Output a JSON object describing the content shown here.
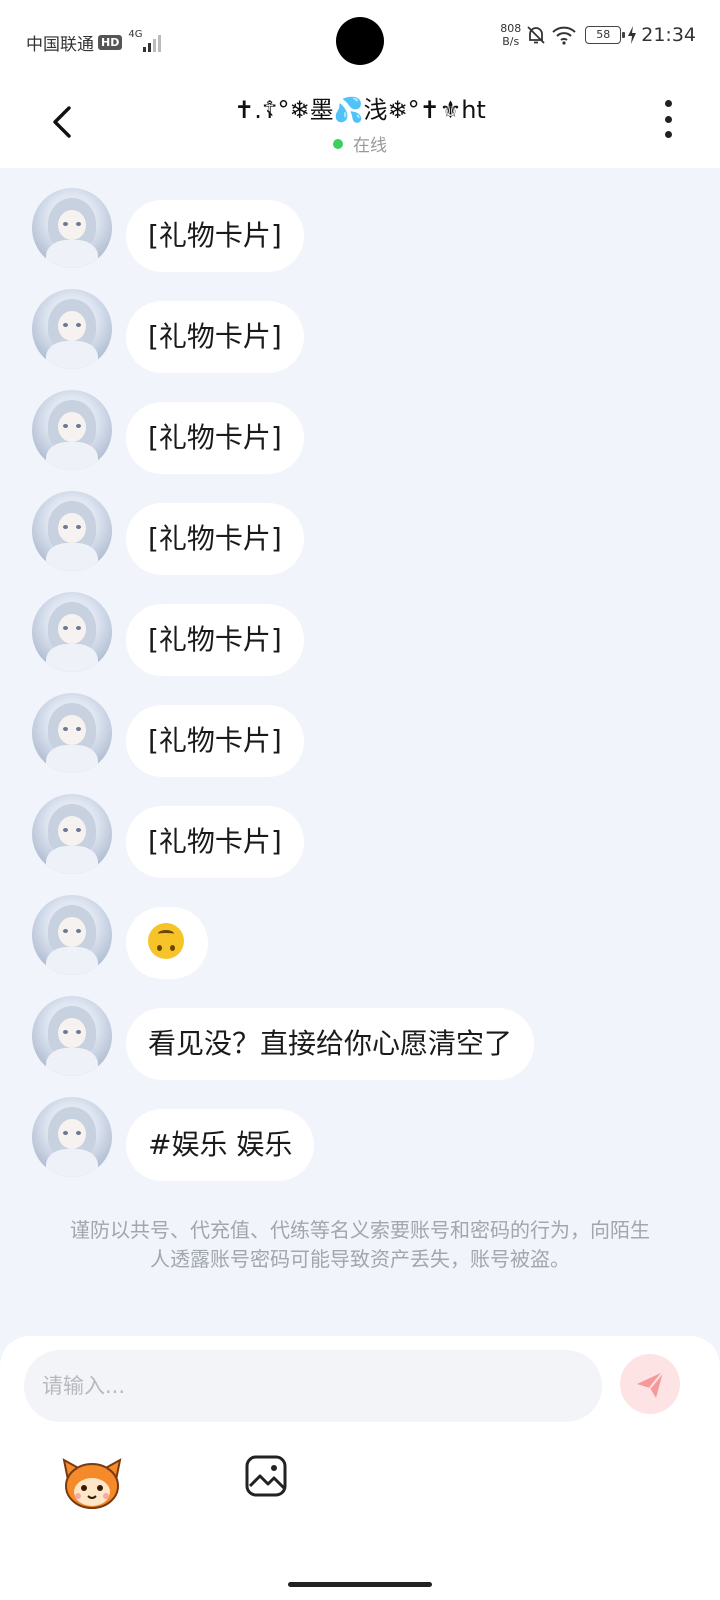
{
  "status_bar": {
    "carrier": "中国联通",
    "hd_label": "HD",
    "network_label": "4G",
    "net_speed_value": "808",
    "net_speed_unit": "B/s",
    "battery": "58",
    "time": "21:34"
  },
  "header": {
    "title": "✝.☦°❄墨💦浅❄°✝⚜ht",
    "status": "在线"
  },
  "messages": [
    {
      "text": "[礼物卡片]"
    },
    {
      "text": "[礼物卡片]"
    },
    {
      "text": "[礼物卡片]"
    },
    {
      "text": "[礼物卡片]"
    },
    {
      "text": "[礼物卡片]"
    },
    {
      "text": "[礼物卡片]"
    },
    {
      "text": "[礼物卡片]"
    },
    {
      "text": "",
      "emoji": "upside-down-face-emoji"
    },
    {
      "text": "看见没？直接给你心愿清空了"
    },
    {
      "text": "#娱乐 娱乐"
    }
  ],
  "warning": "谨防以共号、代充值、代练等名义索要账号和密码的行为，向陌生人透露账号密码可能导致资产丢失，账号被盗。",
  "input": {
    "placeholder": "请输入..."
  },
  "icons": {
    "back": "back-arrow-icon",
    "more": "more-vertical-icon",
    "send": "send-icon",
    "mascot": "mascot-emoji-icon",
    "image": "image-icon"
  },
  "colors": {
    "online": "#3ccf5b",
    "send_button": "#fde3e3",
    "send_icon": "#f59a9a",
    "mascot_orange": "#f58a2a",
    "background": "#f1f4fb"
  }
}
